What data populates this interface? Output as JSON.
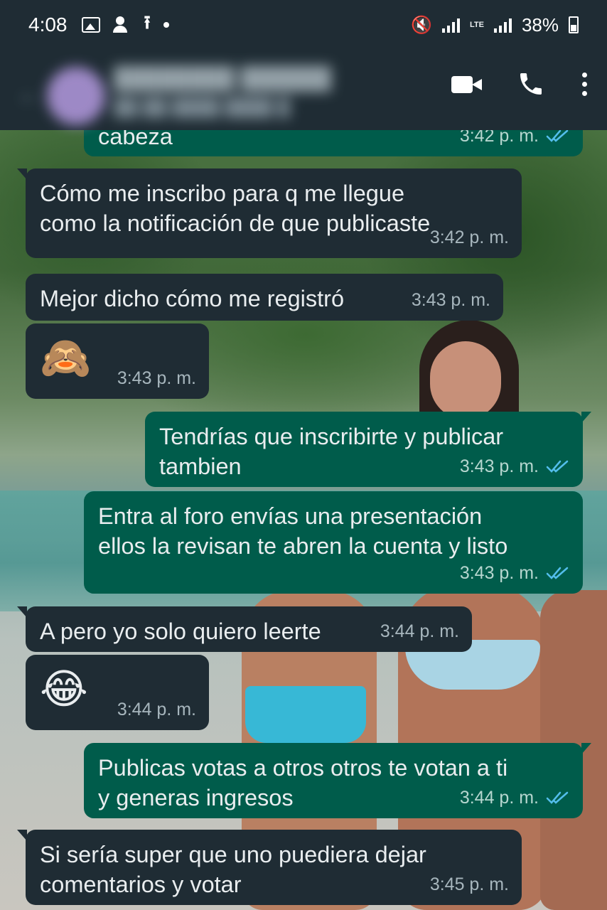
{
  "status_bar": {
    "time": "4:08",
    "network": "LTE",
    "battery": "38%",
    "icons": [
      "photo-icon",
      "add-user-icon",
      "upload-icon",
      "dot-icon",
      "mute-icon",
      "signal-icon",
      "battery-icon"
    ]
  },
  "header": {
    "actions": [
      "video-call-icon",
      "phone-call-icon",
      "more-options-icon"
    ]
  },
  "colors": {
    "bar": "#1f2c34",
    "incoming_bubble": "#1f2c34",
    "outgoing_bubble": "#005c4b",
    "read_tick": "#53bdeb"
  },
  "messages": [
    {
      "direction": "out",
      "text": "cabeza",
      "time": "3:42 p. m.",
      "read": true
    },
    {
      "direction": "in",
      "text": "Cómo me inscribo para q me llegue\ncomo la notificación de que publicaste",
      "time": "3:42 p. m."
    },
    {
      "direction": "in",
      "text": "Mejor dicho cómo me registró",
      "time": "3:43 p. m."
    },
    {
      "direction": "in",
      "text": "🙈",
      "time": "3:43 p. m.",
      "emoji": true
    },
    {
      "direction": "out",
      "text": "Tendrías que inscribirte y publicar\ntambien",
      "time": "3:43 p. m.",
      "read": true
    },
    {
      "direction": "out",
      "text": "Entra al foro envías una presentación\nellos la revisan te abren la cuenta y listo",
      "time": "3:43 p. m.",
      "read": true
    },
    {
      "direction": "in",
      "text": "A pero yo solo quiero leerte",
      "time": "3:44 p. m."
    },
    {
      "direction": "in",
      "text": "😂",
      "time": "3:44 p. m.",
      "emoji": true
    },
    {
      "direction": "out",
      "text": "Publicas votas a otros otros te votan a ti\ny generas ingresos",
      "time": "3:44 p. m.",
      "read": true
    },
    {
      "direction": "in",
      "text": "Si sería super que uno puediera dejar\ncomentarios  y votar",
      "time": "3:45 p. m."
    }
  ]
}
